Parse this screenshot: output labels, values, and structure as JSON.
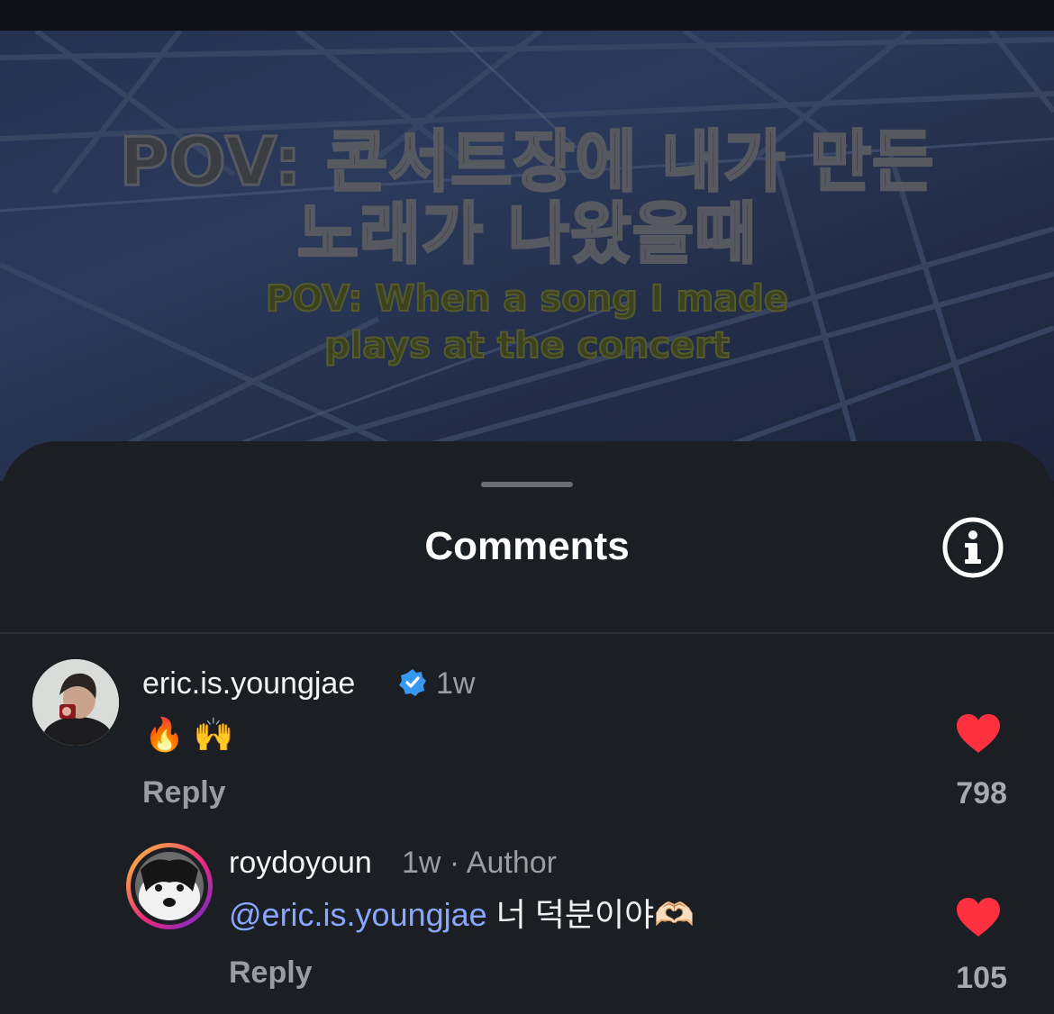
{
  "video": {
    "caption_korean": [
      "POV: 콘서트장에 내가 만든",
      "노래가 나왔을때"
    ],
    "caption_english": [
      "POV: When a song I made",
      "plays at the concert"
    ]
  },
  "sheet": {
    "title": "Comments",
    "info_icon": "info-icon"
  },
  "comments": [
    {
      "username": "eric.is.youngjae",
      "verified": true,
      "time": "1w",
      "text": "🔥 🙌",
      "reply_label": "Reply",
      "likes": "798"
    }
  ],
  "replies": [
    {
      "username": "roydoyoun",
      "meta": "1w · Author",
      "mention": "@eric.is.youngjae",
      "text": " 너 덕분이야🫶🏻",
      "reply_label": "Reply",
      "likes": "105"
    }
  ],
  "colors": {
    "like": "#ff3040",
    "mention": "#8aa7ff",
    "verified": "#3897f0",
    "sheet_bg": "#1b1e22"
  }
}
